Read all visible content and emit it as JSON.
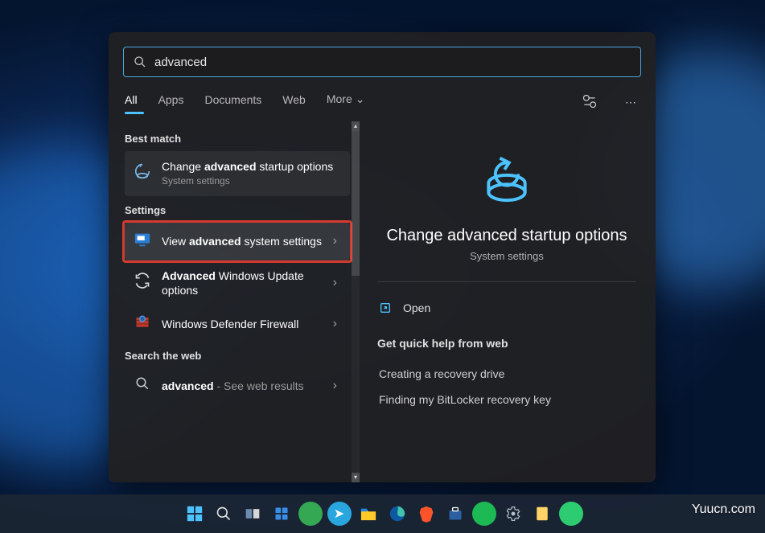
{
  "search": {
    "value": "advanced"
  },
  "tabs": [
    "All",
    "Apps",
    "Documents",
    "Web",
    "More"
  ],
  "sections": {
    "best_match": "Best match",
    "settings": "Settings",
    "search_web": "Search the web"
  },
  "results": {
    "best_match": {
      "title_pre": "Change ",
      "title_bold": "advanced",
      "title_post": " startup options",
      "sub": "System settings"
    },
    "settings": [
      {
        "title_pre": "View ",
        "title_bold": "advanced",
        "title_post": " system settings",
        "sub": ""
      },
      {
        "title_pre": "",
        "title_bold": "Advanced",
        "title_post": " Windows Update options",
        "sub": ""
      },
      {
        "title_pre": "Windows Defender Firewall",
        "title_bold": "",
        "title_post": "",
        "sub": ""
      }
    ],
    "web": {
      "title_pre": "",
      "title_bold": "advanced",
      "title_post": "",
      "sub": " - See web results"
    }
  },
  "preview": {
    "title": "Change advanced startup options",
    "sub": "System settings",
    "open": "Open",
    "help_heading": "Get quick help from web",
    "help_links": [
      "Creating a recovery drive",
      "Finding my BitLocker recovery key"
    ]
  },
  "watermark": "Yuucn.com"
}
